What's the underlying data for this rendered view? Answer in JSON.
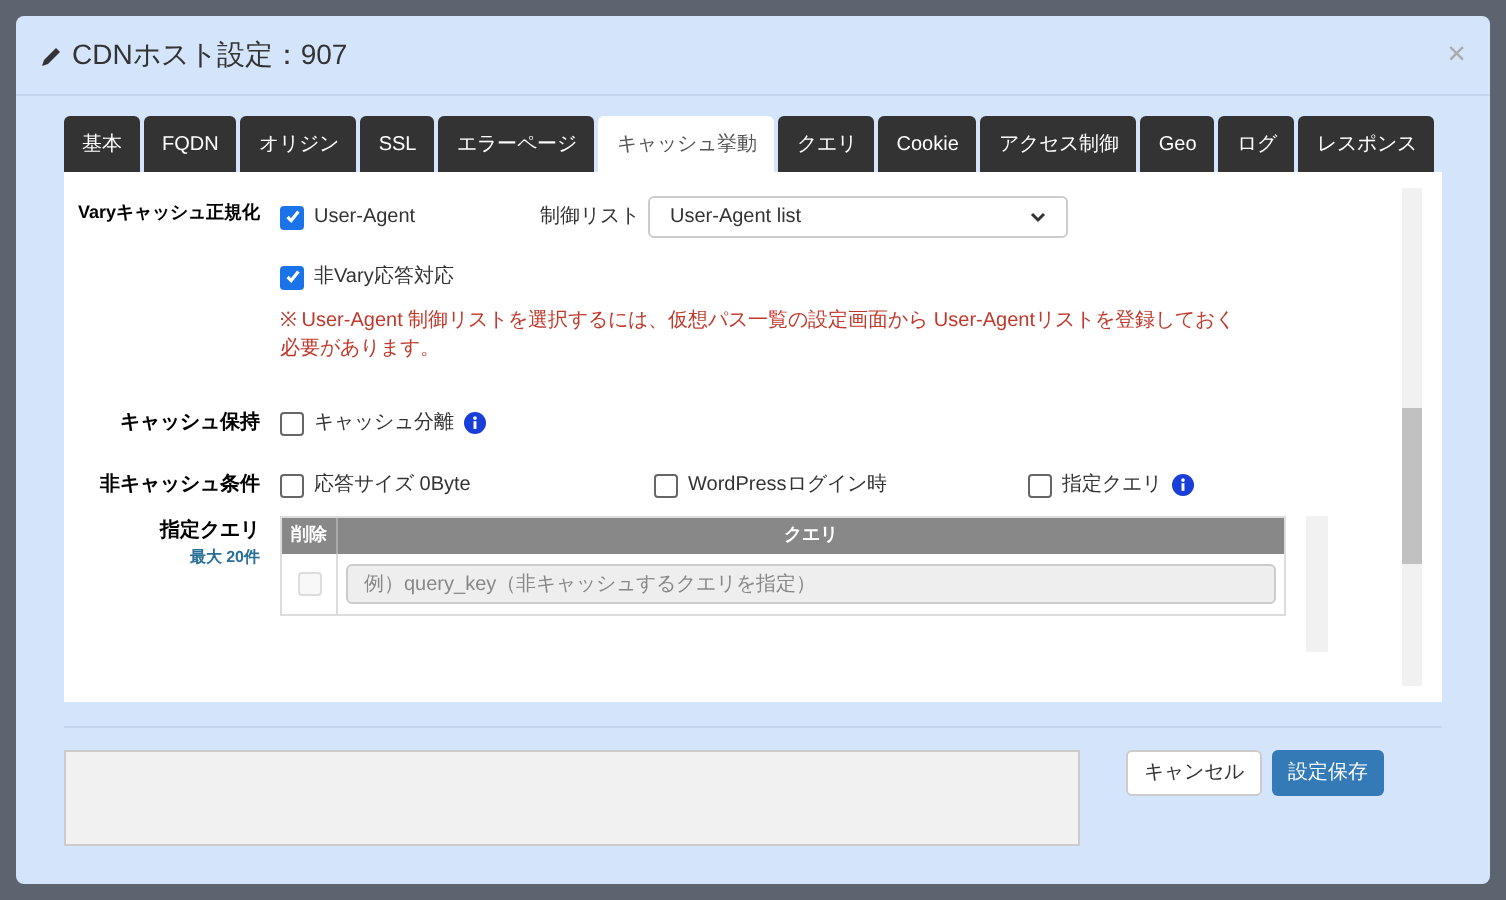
{
  "dialog": {
    "title": "CDNホスト設定：907",
    "close": "×"
  },
  "tabs": [
    {
      "label": "基本",
      "selected": false
    },
    {
      "label": "FQDN",
      "selected": false
    },
    {
      "label": "オリジン",
      "selected": false
    },
    {
      "label": "SSL",
      "selected": false
    },
    {
      "label": "エラーページ",
      "selected": false
    },
    {
      "label": "キャッシュ挙動",
      "selected": true
    },
    {
      "label": "クエリ",
      "selected": false
    },
    {
      "label": "Cookie",
      "selected": false
    },
    {
      "label": "アクセス制御",
      "selected": false
    },
    {
      "label": "Geo",
      "selected": false
    },
    {
      "label": "ログ",
      "selected": false
    },
    {
      "label": "レスポンス",
      "selected": false
    }
  ],
  "vary": {
    "label": "Varyキャッシュ正規化",
    "user_agent": {
      "label": "User-Agent",
      "checked": true
    },
    "control_list": {
      "label": "制御リスト",
      "value": "User-Agent list"
    },
    "non_vary": {
      "label": "非Vary応答対応",
      "checked": true
    },
    "note": "※ User-Agent 制御リストを選択するには、仮想パス一覧の設定画面から User-Agentリストを登録しておく必要があります。"
  },
  "cache_hold": {
    "label": "キャッシュ保持",
    "options": [
      {
        "label": "キャッシュ分離",
        "checked": false,
        "info": true
      }
    ]
  },
  "non_cache": {
    "label": "非キャッシュ条件",
    "options": [
      {
        "label": "応答サイズ 0Byte",
        "checked": false,
        "info": false
      },
      {
        "label": "WordPressログイン時",
        "checked": false,
        "info": false
      },
      {
        "label": "指定クエリ",
        "checked": false,
        "info": true
      }
    ]
  },
  "query": {
    "label": "指定クエリ",
    "sublabel": "最大 20件",
    "columns": [
      "削除",
      "クエリ"
    ],
    "rows": [
      {
        "delete": false,
        "placeholder": "例）query_key（非キャッシュするクエリを指定）"
      }
    ]
  },
  "footer": {
    "buttons": [
      {
        "label": "キャンセル",
        "kind": "default"
      },
      {
        "label": "設定保存",
        "kind": "primary"
      }
    ]
  }
}
